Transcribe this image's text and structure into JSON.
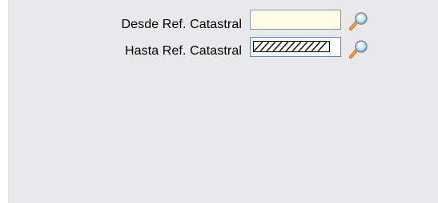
{
  "form": {
    "desde": {
      "label": "Desde Ref. Catastral",
      "value": "",
      "lookup_icon": "magnifier-icon"
    },
    "hasta": {
      "label": "Hasta Ref. Catastral",
      "value": "",
      "lookup_icon": "magnifier-icon"
    }
  },
  "colors": {
    "panel_background": "#e9e9eb",
    "field_background": "#fdfbe3",
    "field_border": "#7f9db9",
    "focused_border": "#5a8ac9"
  }
}
